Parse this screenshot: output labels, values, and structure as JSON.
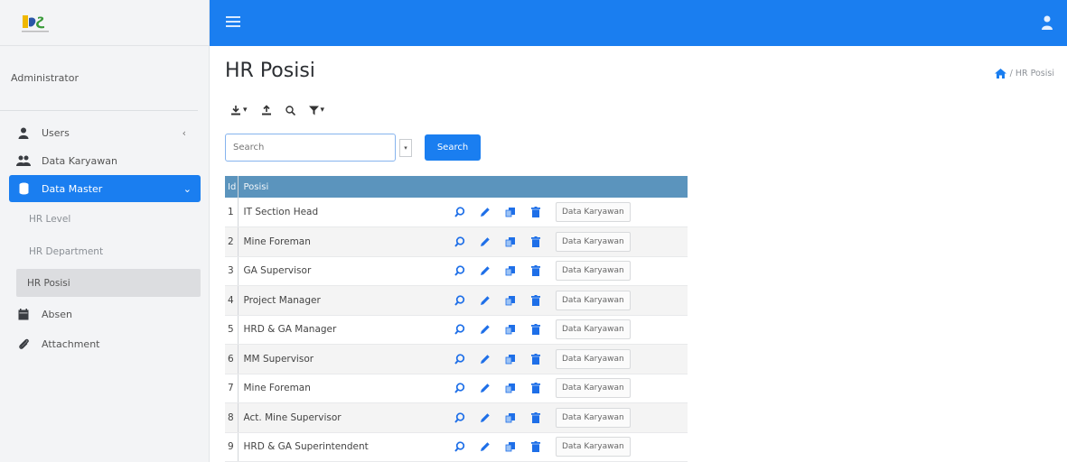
{
  "app": {
    "admin_label": "Administrator",
    "page_title": "HR Posisi"
  },
  "breadcrumb": {
    "current": "/ HR Posisi"
  },
  "sidebar": {
    "items": [
      {
        "label": "Users",
        "icon": "user-icon"
      },
      {
        "label": "Data Karyawan",
        "icon": "users-icon"
      },
      {
        "label": "Data Master",
        "icon": "database-icon"
      },
      {
        "label": "Absen",
        "icon": "calendar-icon"
      },
      {
        "label": "Attachment",
        "icon": "paperclip-icon"
      }
    ],
    "subitems": [
      {
        "label": "HR Level"
      },
      {
        "label": "HR Department"
      },
      {
        "label": "HR Posisi"
      }
    ]
  },
  "search": {
    "placeholder": "Search",
    "button_label": "Search"
  },
  "table": {
    "headers": [
      "Id",
      "Posisi"
    ],
    "row_button_label": "Data Karyawan",
    "rows": [
      {
        "id": "1",
        "posisi": "IT Section Head"
      },
      {
        "id": "2",
        "posisi": "Mine Foreman"
      },
      {
        "id": "3",
        "posisi": "GA Supervisor"
      },
      {
        "id": "4",
        "posisi": "Project Manager"
      },
      {
        "id": "5",
        "posisi": "HRD & GA Manager"
      },
      {
        "id": "6",
        "posisi": "MM Supervisor"
      },
      {
        "id": "7",
        "posisi": "Mine Foreman"
      },
      {
        "id": "8",
        "posisi": "Act. Mine Supervisor"
      },
      {
        "id": "9",
        "posisi": "HRD & GA Superintendent"
      }
    ]
  },
  "colors": {
    "primary": "#1a7ef0",
    "table_header": "#5b94bd",
    "icon_blue": "#1e6fe8"
  }
}
